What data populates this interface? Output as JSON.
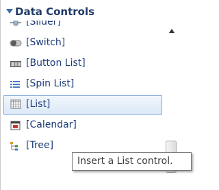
{
  "header": {
    "title": "Data Controls"
  },
  "items": [
    {
      "label": "[Slider]",
      "icon": "slider-icon"
    },
    {
      "label": "[Switch]",
      "icon": "switch-icon"
    },
    {
      "label": "[Button List]",
      "icon": "button-list-icon"
    },
    {
      "label": "[Spin List]",
      "icon": "spin-list-icon"
    },
    {
      "label": "[List]",
      "icon": "list-icon",
      "selected": true
    },
    {
      "label": "[Calendar]",
      "icon": "calendar-icon"
    },
    {
      "label": "[Tree]",
      "icon": "tree-icon"
    }
  ],
  "tooltip": {
    "text": "Insert a List control."
  },
  "colors": {
    "label": "#1b3a78",
    "selection": "#7aa7d9",
    "header_arrow": "#3a6fb0"
  }
}
